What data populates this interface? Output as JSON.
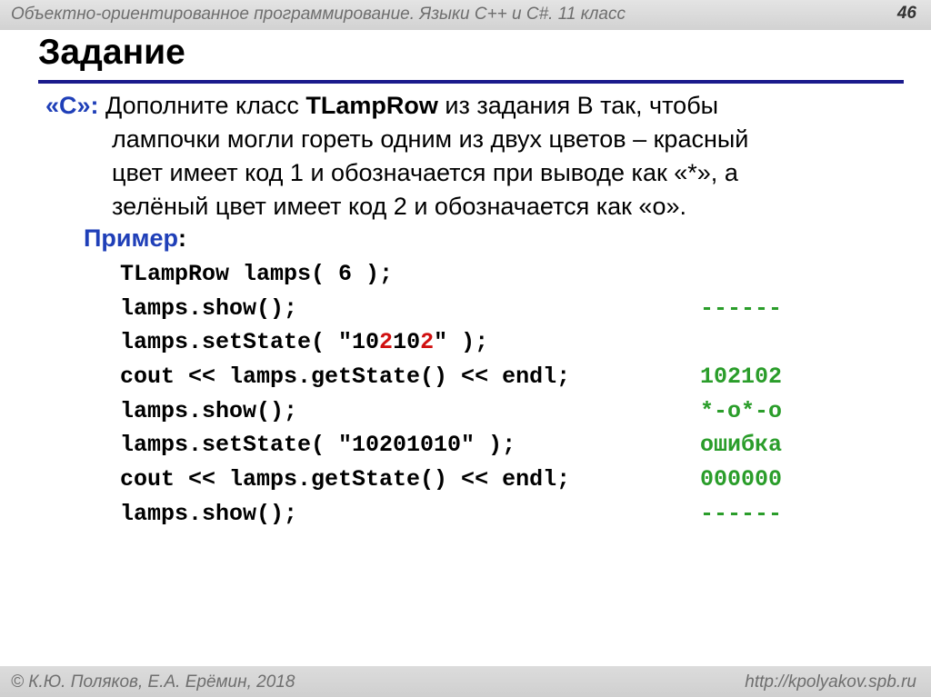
{
  "header": {
    "course": "Объектно-ориентированное программирование. Языки C++ и C#. 11 класс",
    "page_number": "46"
  },
  "title": "Задание",
  "task": {
    "label": "«С»:",
    "line1_pre": " Дополните класс ",
    "class_name": "TLampRow",
    "line1_post": " из задания B так, чтобы",
    "line2": "лампочки могли гореть одним из двух цветов – красный",
    "line3": "цвет имеет код 1 и обозначается при выводе как «*», а",
    "line4": "зелёный цвет имеет код 2 и обозначается как «о»."
  },
  "example": {
    "label": "Пример",
    "colon": ":"
  },
  "code": {
    "line1": "TLampRow lamps( 6 );",
    "line2": "lamps.show();",
    "line3_pre": "lamps.setState( \"10",
    "line3_hl1": "2",
    "line3_mid": "10",
    "line3_hl2": "2",
    "line3_post": "\" );",
    "line4": "cout << lamps.getState() << endl;",
    "line5": "lamps.show();",
    "line6": "lamps.setState( \"10201010\" );",
    "line7": "cout << lamps.getState() << endl;",
    "line8": "lamps.show();"
  },
  "output": {
    "line1": "",
    "line2": "------",
    "line3": "",
    "line4": "102102",
    "line5": "*-o*-o",
    "line6": "ошибка",
    "line7": "000000",
    "line8": "------"
  },
  "footer": {
    "authors": "© К.Ю. Поляков, Е.А. Ерёмин, 2018",
    "url": "http://kpolyakov.spb.ru"
  },
  "colors": {
    "accent_blue": "#1f3fb8",
    "rule_blue": "#1a1a8c",
    "output_green": "#2a9d2a",
    "highlight_red": "#d01010"
  }
}
